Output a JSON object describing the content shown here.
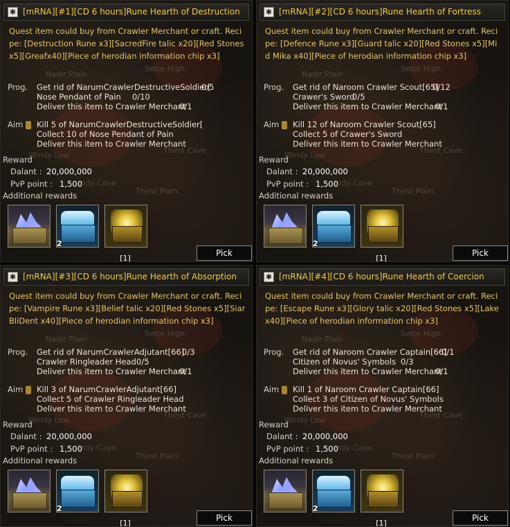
{
  "quests": [
    {
      "title": "[mRNA][#1][CD 6 hours]Rune Hearth of Destruction",
      "description": "Quest item could buy from Crawler Merchant or craft. Recipe: [Destruction Rune x3][SacredFire talic x20][Red Stones x5][Greafx40][Piece of herodian information chip x3]",
      "prog_label": "Prog.",
      "prog": [
        {
          "text": "Get rid of NarumCrawlerDestructiveSoldier[",
          "count": "0/5"
        },
        {
          "text": "Nose Pendant of Pain",
          "count": "0/10"
        },
        {
          "text": "Deliver this item to Crawler Merchant",
          "count": "0/1"
        }
      ],
      "aim_label": "Aim",
      "aim": [
        "Kill 5 of NarumCrawlerDestructiveSoldier[",
        "Collect 10 of Nose Pendant of Pain",
        "Deliver this item to Crawler Merchant"
      ],
      "reward_label": "Reward",
      "dalant_label": "Dalant :",
      "dalant": "20,000,000",
      "pvp_label": "PvP point :",
      "pvp": "1,500",
      "additional_label": "Additional rewards",
      "reward_qty": "2",
      "page": "[1]",
      "pick": "Pick"
    },
    {
      "title": "[mRNA][#2][CD 6 hours]Rune Hearth of Fortress",
      "description": "Quest item could buy from Crawler Merchant or craft. Recipe: [Defence Rune x3][Guard talic x20][Red Stones x5][Mid Mika x40][Piece of herodian information chip x3]",
      "prog_label": "Prog.",
      "prog": [
        {
          "text": "Get rid of Naroom Crawler Scout[65]",
          "count": "0/12"
        },
        {
          "text": "Crawer's Sword",
          "count": "0/5"
        },
        {
          "text": "Deliver this item to Crawler Merchant",
          "count": "0/1"
        }
      ],
      "aim_label": "Aim",
      "aim": [
        "Kill 12 of Naroom Crawler Scout[65]",
        "Collect 5 of Crawer's Sword",
        "Deliver this item to Crawler Merchant"
      ],
      "reward_label": "Reward",
      "dalant_label": "Dalant :",
      "dalant": "20,000,000",
      "pvp_label": "PvP point :",
      "pvp": "1,500",
      "additional_label": "Additional rewards",
      "reward_qty": "2",
      "page": "[1]",
      "pick": "Pick"
    },
    {
      "title": "[mRNA][#3][CD 6 hours]Rune Hearth of Absorption",
      "description": "Quest item could buy from Crawler Merchant or craft. Recipe: [Vampire Rune x3][Belief talic x20][Red Stones x5][Siar BliDent x40][Piece of herodian information chip x3]",
      "prog_label": "Prog.",
      "prog": [
        {
          "text": "Get rid of NarumCrawlerAdjutant[66]",
          "count": "0/3"
        },
        {
          "text": "Crawler Ringleader Head",
          "count": "0/5"
        },
        {
          "text": "Deliver this item to Crawler Merchant",
          "count": "0/1"
        }
      ],
      "aim_label": "Aim",
      "aim": [
        "Kill 3 of NarumCrawlerAdjutant[66]",
        "Collect 5 of Crawler Ringleader Head",
        "Deliver this item to Crawler Merchant"
      ],
      "reward_label": "Reward",
      "dalant_label": "Dalant :",
      "dalant": "20,000,000",
      "pvp_label": "PvP point :",
      "pvp": "1,500",
      "additional_label": "Additional rewards",
      "reward_qty": "2",
      "page": "[1]",
      "pick": "Pick"
    },
    {
      "title": "[mRNA][#4][CD 6 hours]Rune Hearth of Coercion",
      "description": "Quest item could buy from Crawler Merchant or craft. Recipe: [Escape Rune x3][Glory talic x20][Red Stones x5][Lake x40][Piece of herodian information chip x3]",
      "prog_label": "Prog.",
      "prog": [
        {
          "text": "Get rid of Naroom Crawler Captain[66]",
          "count": "0/1"
        },
        {
          "text": "Citizen of Novus' Symbols",
          "count": "0/3"
        },
        {
          "text": "Deliver this item to Crawler Merchant",
          "count": "0/1"
        }
      ],
      "aim_label": "Aim",
      "aim": [
        "Kill 1 of Naroom Crawler Captain[66]",
        "Collect 3 of Citizen of Novus' Symbols",
        "Deliver this item to Crawler Merchant"
      ],
      "reward_label": "Reward",
      "dalant_label": "Dalant :",
      "dalant": "20,000,000",
      "pvp_label": "PvP point :",
      "pvp": "1,500",
      "additional_label": "Additional rewards",
      "reward_qty": "2",
      "page": "[1]",
      "pick": "Pick"
    }
  ],
  "map_labels": {
    "nadir": "Nadir Plain",
    "sette": "Sette High",
    "windy": "Windy Low",
    "thirst_cave": "Thirst Cave",
    "thirst_plain": "Thirst Plain",
    "windy_cave": "indy Cave"
  },
  "icons": {
    "title": "quest-scroll-icon",
    "reward_1": "crystal-chest-icon",
    "reward_2": "blue-chest-icon",
    "reward_3": "gold-chest-icon"
  },
  "colors": {
    "title": "#f3c84a",
    "description": "#e6c56b",
    "text": "#ece6d6"
  }
}
